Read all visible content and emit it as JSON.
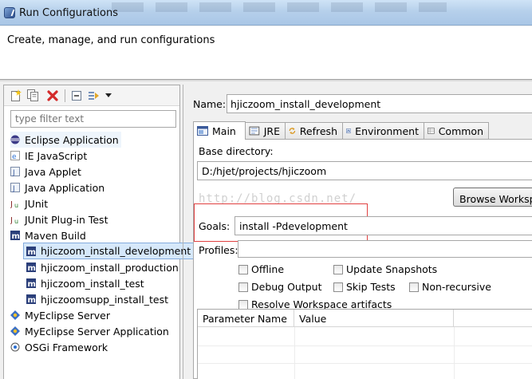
{
  "window": {
    "title": "Run Configurations"
  },
  "banner": {
    "title": "Create, manage, and run configurations"
  },
  "toolbar": {
    "buttons": [
      "new-config-icon",
      "duplicate-icon",
      "delete-icon",
      "collapse-all-icon",
      "filter-icon",
      "dropdown-arrow-icon"
    ],
    "colors": {
      "delete": "#d42a2a"
    }
  },
  "filter": {
    "placeholder": "type filter text"
  },
  "tree": {
    "items": [
      {
        "label": "Eclipse Application",
        "icon": "eclipse-icon"
      },
      {
        "label": "IE JavaScript",
        "icon": "ie-icon"
      },
      {
        "label": "Java Applet",
        "icon": "applet-icon"
      },
      {
        "label": "Java Application",
        "icon": "java-app-icon"
      },
      {
        "label": "JUnit",
        "icon": "junit-icon"
      },
      {
        "label": "JUnit Plug-in Test",
        "icon": "junit-plugin-icon"
      },
      {
        "label": "Maven Build",
        "icon": "maven-icon"
      },
      {
        "label": "hjiczoom_install_development",
        "icon": "maven-icon"
      },
      {
        "label": "hjiczoom_install_production",
        "icon": "maven-icon"
      },
      {
        "label": "hjiczoom_install_test",
        "icon": "maven-icon"
      },
      {
        "label": "hjiczoomsupp_install_test",
        "icon": "maven-icon"
      },
      {
        "label": "MyEclipse Server",
        "icon": "server-icon"
      },
      {
        "label": "MyEclipse Server Application",
        "icon": "server-app-icon"
      },
      {
        "label": "OSGi Framework",
        "icon": "osgi-icon"
      }
    ],
    "selected": "hjiczoom_install_development"
  },
  "form": {
    "name_label": "Name:",
    "name_value": "hjiczoom_install_development",
    "tabs": [
      {
        "label": "Main",
        "icon": "main-tab-icon"
      },
      {
        "label": "JRE",
        "icon": "jre-icon"
      },
      {
        "label": "Refresh",
        "icon": "refresh-icon"
      },
      {
        "label": "Environment",
        "icon": "environment-icon"
      },
      {
        "label": "Common",
        "icon": "common-icon"
      }
    ],
    "base_dir_label": "Base directory:",
    "base_dir_value": "D:/hjet/projects/hjiczoom",
    "browse_label": "Browse Workspa",
    "watermark": "http://blog.csdn.net/",
    "goals_label": "Goals:",
    "goals_value": "install -Pdevelopment",
    "profiles_label": "Profiles:",
    "profiles_value": "",
    "checkboxes": {
      "offline": "Offline",
      "update_snapshots": "Update Snapshots",
      "debug_output": "Debug Output",
      "skip_tests": "Skip Tests",
      "non_recursive": "Non-recursive",
      "resolve_workspace": "Resolve Workspace artifacts"
    },
    "table": {
      "col_name": "Parameter Name",
      "col_value": "Value"
    }
  }
}
